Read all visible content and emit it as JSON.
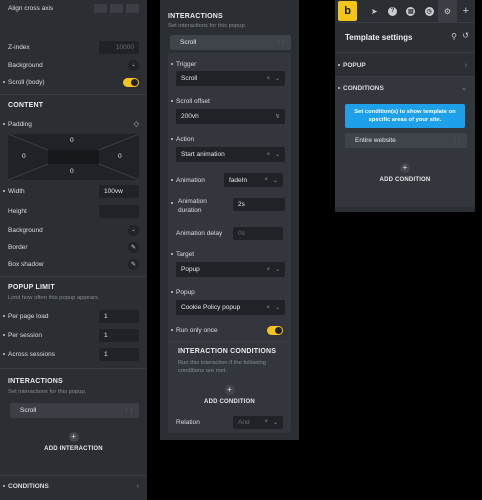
{
  "panel1": {
    "align_cross_axis": "Align cross axis",
    "zindex_label": "Z-index",
    "zindex_placeholder": "10000",
    "background_label": "Background",
    "scroll_body_label": "Scroll (body)",
    "content_heading": "CONTENT",
    "padding_label": "Padding",
    "padding_top": "0",
    "padding_left": "0",
    "padding_right": "0",
    "padding_bottom": "0",
    "width_label": "Width",
    "width_value": "100vw",
    "height_label": "Height",
    "background2_label": "Background",
    "border_label": "Border",
    "boxshadow_label": "Box shadow",
    "popup_limit_heading": "POPUP LIMIT",
    "popup_limit_sub": "Limit how often this popup appears.",
    "per_page_load_label": "Per page load",
    "per_page_load_value": "1",
    "per_session_label": "Per session",
    "per_session_value": "1",
    "across_sessions_label": "Across sessions",
    "across_sessions_value": "1",
    "interactions_heading": "INTERACTIONS",
    "interactions_sub": "Set interactions for this popup.",
    "interaction_item": "Scroll",
    "add_interaction": "ADD INTERACTION",
    "conditions_label": "CONDITIONS"
  },
  "panel2": {
    "heading": "INTERACTIONS",
    "sub": "Set interactions for this popup.",
    "interaction_item": "Scroll",
    "trigger_label": "Trigger",
    "trigger_value": "Scroll",
    "scroll_offset_label": "Scroll offset",
    "scroll_offset_value": "200vh",
    "action_label": "Action",
    "action_value": "Start animation",
    "animation_label": "Animation",
    "animation_value": "fadeIn",
    "animation_duration_label": "Animation duration",
    "animation_duration_value": "2s",
    "animation_delay_label": "Animation delay",
    "animation_delay_placeholder": "0s",
    "target_label": "Target",
    "target_value": "Popup",
    "popup_label": "Popup",
    "popup_value": "Cookie Policy popup",
    "run_only_once_label": "Run only once",
    "ic_heading": "INTERACTION CONDITIONS",
    "ic_sub": "Run this interaction if the following conditions are met.",
    "add_condition": "ADD CONDITION",
    "relation_label": "Relation",
    "relation_value": "And"
  },
  "panel3": {
    "logo": "b",
    "title": "Template settings",
    "popup_label": "POPUP",
    "conditions_label": "CONDITIONS",
    "notice": "Set condition(s) to show template on specific areas of your site.",
    "condition_item": "Entire website",
    "add_condition": "ADD CONDITION"
  },
  "colors": {
    "accent": "#f5c518",
    "panel_bg": "#2b2e33",
    "input_bg": "#1f2226",
    "notice_bg": "#1fa0ea"
  }
}
